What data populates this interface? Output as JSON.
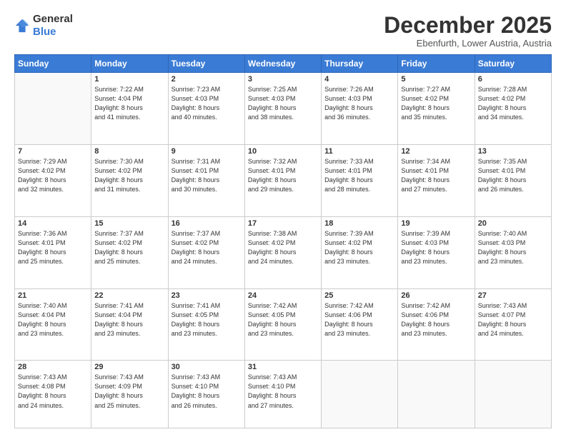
{
  "logo": {
    "general": "General",
    "blue": "Blue"
  },
  "header": {
    "month": "December 2025",
    "location": "Ebenfurth, Lower Austria, Austria"
  },
  "days_of_week": [
    "Sunday",
    "Monday",
    "Tuesday",
    "Wednesday",
    "Thursday",
    "Friday",
    "Saturday"
  ],
  "weeks": [
    [
      {
        "day": "",
        "info": ""
      },
      {
        "day": "1",
        "info": "Sunrise: 7:22 AM\nSunset: 4:04 PM\nDaylight: 8 hours\nand 41 minutes."
      },
      {
        "day": "2",
        "info": "Sunrise: 7:23 AM\nSunset: 4:03 PM\nDaylight: 8 hours\nand 40 minutes."
      },
      {
        "day": "3",
        "info": "Sunrise: 7:25 AM\nSunset: 4:03 PM\nDaylight: 8 hours\nand 38 minutes."
      },
      {
        "day": "4",
        "info": "Sunrise: 7:26 AM\nSunset: 4:03 PM\nDaylight: 8 hours\nand 36 minutes."
      },
      {
        "day": "5",
        "info": "Sunrise: 7:27 AM\nSunset: 4:02 PM\nDaylight: 8 hours\nand 35 minutes."
      },
      {
        "day": "6",
        "info": "Sunrise: 7:28 AM\nSunset: 4:02 PM\nDaylight: 8 hours\nand 34 minutes."
      }
    ],
    [
      {
        "day": "7",
        "info": "Sunrise: 7:29 AM\nSunset: 4:02 PM\nDaylight: 8 hours\nand 32 minutes."
      },
      {
        "day": "8",
        "info": "Sunrise: 7:30 AM\nSunset: 4:02 PM\nDaylight: 8 hours\nand 31 minutes."
      },
      {
        "day": "9",
        "info": "Sunrise: 7:31 AM\nSunset: 4:01 PM\nDaylight: 8 hours\nand 30 minutes."
      },
      {
        "day": "10",
        "info": "Sunrise: 7:32 AM\nSunset: 4:01 PM\nDaylight: 8 hours\nand 29 minutes."
      },
      {
        "day": "11",
        "info": "Sunrise: 7:33 AM\nSunset: 4:01 PM\nDaylight: 8 hours\nand 28 minutes."
      },
      {
        "day": "12",
        "info": "Sunrise: 7:34 AM\nSunset: 4:01 PM\nDaylight: 8 hours\nand 27 minutes."
      },
      {
        "day": "13",
        "info": "Sunrise: 7:35 AM\nSunset: 4:01 PM\nDaylight: 8 hours\nand 26 minutes."
      }
    ],
    [
      {
        "day": "14",
        "info": "Sunrise: 7:36 AM\nSunset: 4:01 PM\nDaylight: 8 hours\nand 25 minutes."
      },
      {
        "day": "15",
        "info": "Sunrise: 7:37 AM\nSunset: 4:02 PM\nDaylight: 8 hours\nand 25 minutes."
      },
      {
        "day": "16",
        "info": "Sunrise: 7:37 AM\nSunset: 4:02 PM\nDaylight: 8 hours\nand 24 minutes."
      },
      {
        "day": "17",
        "info": "Sunrise: 7:38 AM\nSunset: 4:02 PM\nDaylight: 8 hours\nand 24 minutes."
      },
      {
        "day": "18",
        "info": "Sunrise: 7:39 AM\nSunset: 4:02 PM\nDaylight: 8 hours\nand 23 minutes."
      },
      {
        "day": "19",
        "info": "Sunrise: 7:39 AM\nSunset: 4:03 PM\nDaylight: 8 hours\nand 23 minutes."
      },
      {
        "day": "20",
        "info": "Sunrise: 7:40 AM\nSunset: 4:03 PM\nDaylight: 8 hours\nand 23 minutes."
      }
    ],
    [
      {
        "day": "21",
        "info": "Sunrise: 7:40 AM\nSunset: 4:04 PM\nDaylight: 8 hours\nand 23 minutes."
      },
      {
        "day": "22",
        "info": "Sunrise: 7:41 AM\nSunset: 4:04 PM\nDaylight: 8 hours\nand 23 minutes."
      },
      {
        "day": "23",
        "info": "Sunrise: 7:41 AM\nSunset: 4:05 PM\nDaylight: 8 hours\nand 23 minutes."
      },
      {
        "day": "24",
        "info": "Sunrise: 7:42 AM\nSunset: 4:05 PM\nDaylight: 8 hours\nand 23 minutes."
      },
      {
        "day": "25",
        "info": "Sunrise: 7:42 AM\nSunset: 4:06 PM\nDaylight: 8 hours\nand 23 minutes."
      },
      {
        "day": "26",
        "info": "Sunrise: 7:42 AM\nSunset: 4:06 PM\nDaylight: 8 hours\nand 23 minutes."
      },
      {
        "day": "27",
        "info": "Sunrise: 7:43 AM\nSunset: 4:07 PM\nDaylight: 8 hours\nand 24 minutes."
      }
    ],
    [
      {
        "day": "28",
        "info": "Sunrise: 7:43 AM\nSunset: 4:08 PM\nDaylight: 8 hours\nand 24 minutes."
      },
      {
        "day": "29",
        "info": "Sunrise: 7:43 AM\nSunset: 4:09 PM\nDaylight: 8 hours\nand 25 minutes."
      },
      {
        "day": "30",
        "info": "Sunrise: 7:43 AM\nSunset: 4:10 PM\nDaylight: 8 hours\nand 26 minutes."
      },
      {
        "day": "31",
        "info": "Sunrise: 7:43 AM\nSunset: 4:10 PM\nDaylight: 8 hours\nand 27 minutes."
      },
      {
        "day": "",
        "info": ""
      },
      {
        "day": "",
        "info": ""
      },
      {
        "day": "",
        "info": ""
      }
    ]
  ]
}
